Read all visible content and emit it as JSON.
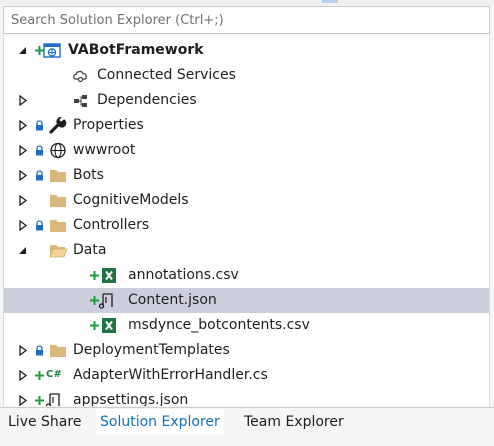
{
  "search": {
    "placeholder": "Search Solution Explorer (Ctrl+;)"
  },
  "colors": {
    "selected_row": "#cccedb",
    "active_tab_text": "#0e70c0",
    "added_plus": "#1a9e3b",
    "folder": "#dcb67a",
    "lock": "#1c6ec7"
  },
  "tree": {
    "project": {
      "label": "VABotFramework",
      "icon": "web-project-icon"
    },
    "connected_services": {
      "label": "Connected Services",
      "icon": "connected-services-icon"
    },
    "dependencies": {
      "label": "Dependencies",
      "icon": "dependencies-icon"
    },
    "properties": {
      "label": "Properties",
      "icon": "wrench-icon"
    },
    "wwwroot": {
      "label": "wwwroot",
      "icon": "globe-icon"
    },
    "bots": {
      "label": "Bots",
      "icon": "folder-icon"
    },
    "cognitive_models": {
      "label": "CognitiveModels",
      "icon": "folder-icon"
    },
    "controllers": {
      "label": "Controllers",
      "icon": "folder-icon"
    },
    "data": {
      "label": "Data",
      "icon": "folder-open-icon"
    },
    "annotations": {
      "label": "annotations.csv",
      "icon": "excel-icon"
    },
    "content": {
      "label": "Content.json",
      "icon": "json-file-icon"
    },
    "botcontents": {
      "label": "msdynce_botcontents.csv",
      "icon": "excel-icon"
    },
    "deployment_templates": {
      "label": "DeploymentTemplates",
      "icon": "folder-icon"
    },
    "adapter": {
      "label": "AdapterWithErrorHandler.cs",
      "icon": "csharp-file-icon",
      "badge": "C#"
    },
    "appsettings": {
      "label": "appsettings.json",
      "icon": "json-file-icon"
    }
  },
  "tabs": [
    {
      "label": "Live Share"
    },
    {
      "label": "Solution Explorer",
      "active": true
    },
    {
      "label": "Team Explorer"
    }
  ]
}
